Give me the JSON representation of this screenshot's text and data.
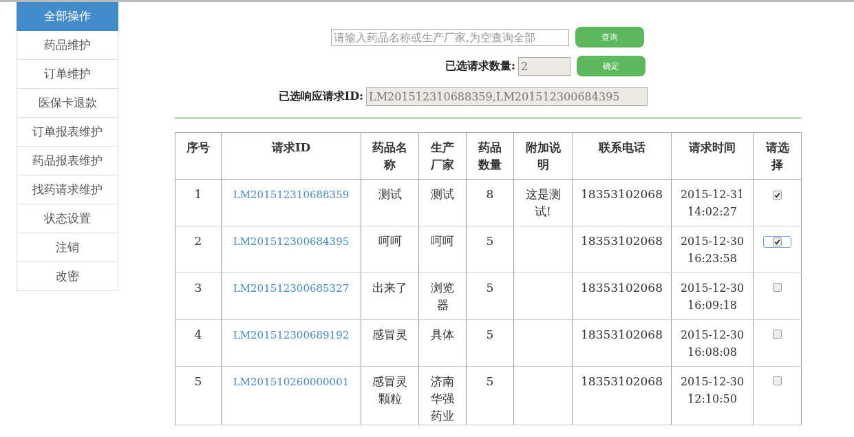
{
  "sidebar": {
    "items": [
      {
        "label": "全部操作",
        "selected": true
      },
      {
        "label": "药品维护",
        "selected": false
      },
      {
        "label": "订单维护",
        "selected": false
      },
      {
        "label": "医保卡退款",
        "selected": false
      },
      {
        "label": "订单报表维护",
        "selected": false
      },
      {
        "label": "药品报表维护",
        "selected": false
      },
      {
        "label": "找药请求维护",
        "selected": false
      },
      {
        "label": "状态设置",
        "selected": false
      },
      {
        "label": "注销",
        "selected": false
      },
      {
        "label": "改密",
        "selected": false
      }
    ]
  },
  "search": {
    "placeholder": "请输入药品名称或生产厂家,为空查询全部",
    "button": "查询"
  },
  "selected_count": {
    "label": "已选请求数量:",
    "value": "2",
    "button": "确定"
  },
  "selected_ids": {
    "label": "已选响应请求ID:",
    "value": "LM201512310688359,LM201512300684395"
  },
  "table": {
    "columns": [
      "序号",
      "请求ID",
      "药品名称",
      "生产厂家",
      "药品数量",
      "附加说明",
      "联系电话",
      "请求时间",
      "请选择"
    ],
    "rows": [
      {
        "index": "1",
        "id": "LM201512310688359",
        "name": "测试",
        "maker": "测试",
        "quantity": "8",
        "note": "这是测试!",
        "phone": "18353102068",
        "date": "2015-12-31",
        "time": "14:02:27",
        "checked": true,
        "focused": false
      },
      {
        "index": "2",
        "id": "LM201512300684395",
        "name": "呵呵",
        "maker": "呵呵",
        "quantity": "5",
        "note": "",
        "phone": "18353102068",
        "date": "2015-12-30",
        "time": "16:23:58",
        "checked": true,
        "focused": true
      },
      {
        "index": "3",
        "id": "LM201512300685327",
        "name": "出来了",
        "maker": "浏览器",
        "quantity": "5",
        "note": "",
        "phone": "18353102068",
        "date": "2015-12-30",
        "time": "16:09:18",
        "checked": false,
        "focused": false
      },
      {
        "index": "4",
        "id": "LM201512300689192",
        "name": "感冒灵",
        "maker": "具体",
        "quantity": "5",
        "note": "",
        "phone": "18353102068",
        "date": "2015-12-30",
        "time": "16:08:08",
        "checked": false,
        "focused": false
      },
      {
        "index": "5",
        "id": "LM201510260000001",
        "name": "感冒灵颗粒",
        "maker": "济南华强药业",
        "quantity": "5",
        "note": "",
        "phone": "18353102068",
        "date": "2015-12-30",
        "time": "12:10:50",
        "checked": false,
        "focused": false
      }
    ]
  }
}
